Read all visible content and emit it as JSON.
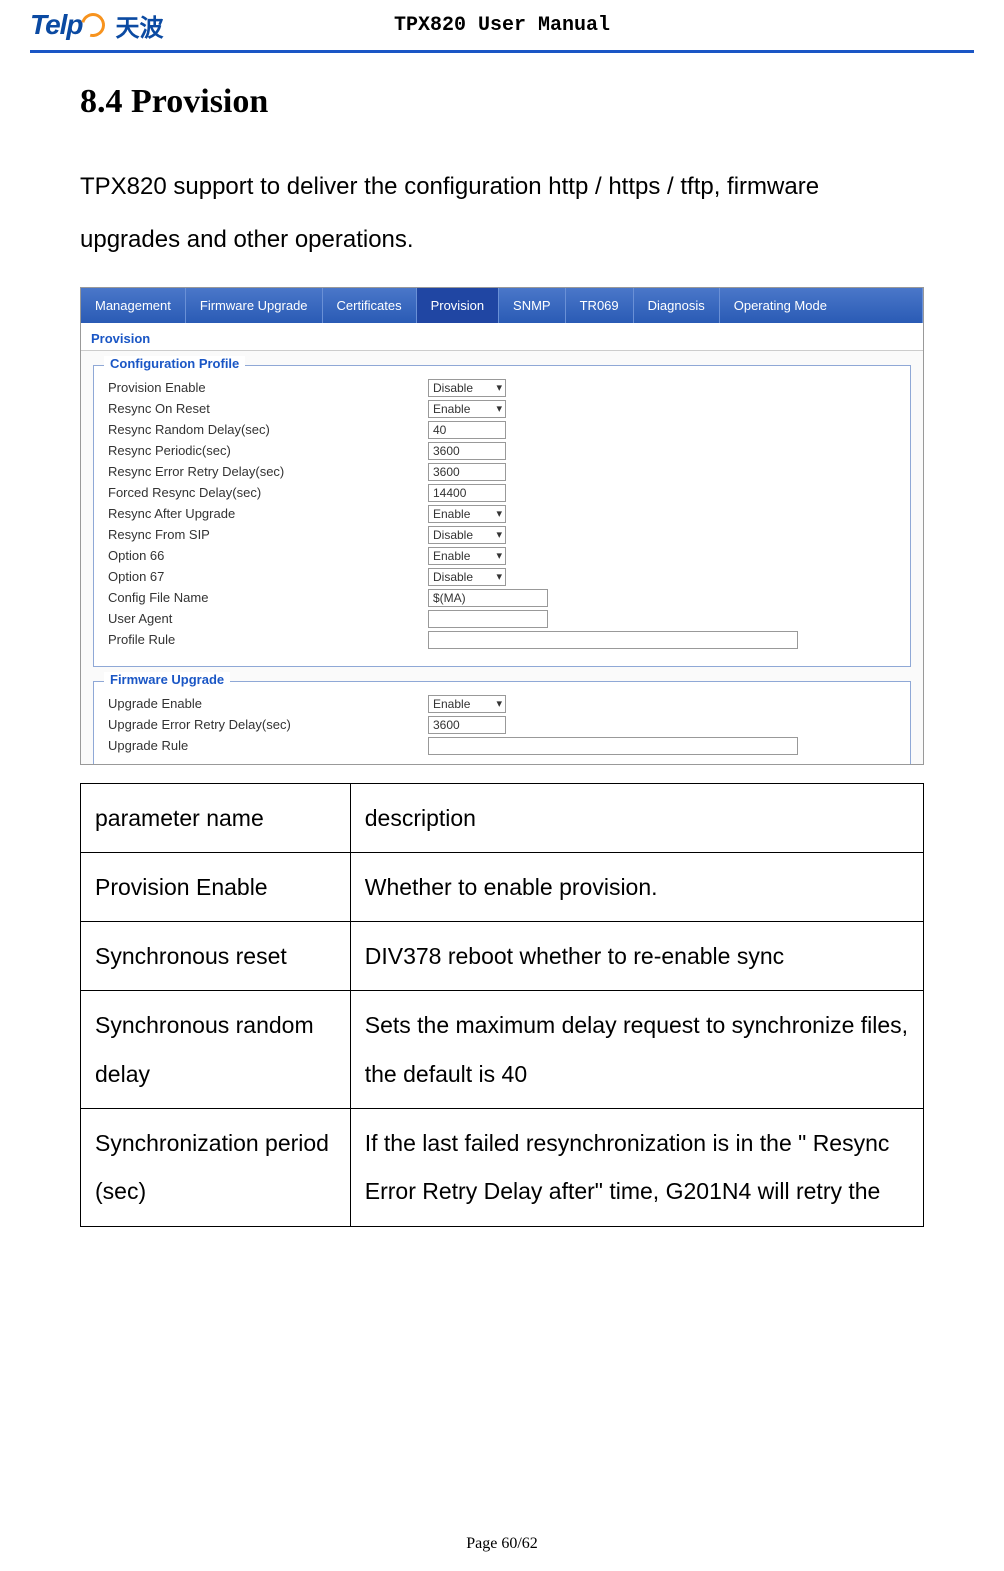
{
  "header": {
    "logo_en": "Telp",
    "logo_cn": "天波",
    "doc_title": "TPX820 User Manual"
  },
  "section": {
    "title": "8.4 Provision",
    "intro": "TPX820 support to deliver the configuration http / https / tftp, firmware upgrades and other operations."
  },
  "ui": {
    "tabs": [
      "Management",
      "Firmware Upgrade",
      "Certificates",
      "Provision",
      "SNMP",
      "TR069",
      "Diagnosis",
      "Operating Mode"
    ],
    "active_tab": "Provision",
    "section_header": "Provision",
    "group1": {
      "legend": "Configuration Profile",
      "rows": [
        {
          "label": "Provision Enable",
          "type": "select",
          "value": "Disable"
        },
        {
          "label": "Resync On Reset",
          "type": "select",
          "value": "Enable"
        },
        {
          "label": "Resync Random Delay(sec)",
          "type": "input-sm",
          "value": "40"
        },
        {
          "label": "Resync Periodic(sec)",
          "type": "input-sm",
          "value": "3600"
        },
        {
          "label": "Resync Error Retry Delay(sec)",
          "type": "input-sm",
          "value": "3600"
        },
        {
          "label": "Forced Resync Delay(sec)",
          "type": "input-sm",
          "value": "14400"
        },
        {
          "label": "Resync After Upgrade",
          "type": "select",
          "value": "Enable"
        },
        {
          "label": "Resync From SIP",
          "type": "select",
          "value": "Disable"
        },
        {
          "label": "Option 66",
          "type": "select",
          "value": "Enable"
        },
        {
          "label": "Option 67",
          "type": "select",
          "value": "Disable"
        },
        {
          "label": "Config File Name",
          "type": "input",
          "value": "$(MA)"
        },
        {
          "label": "User Agent",
          "type": "input",
          "value": ""
        },
        {
          "label": "Profile Rule",
          "type": "input-wide",
          "value": ""
        }
      ]
    },
    "group2": {
      "legend": "Firmware Upgrade",
      "rows": [
        {
          "label": "Upgrade Enable",
          "type": "select",
          "value": "Enable"
        },
        {
          "label": "Upgrade Error Retry Delay(sec)",
          "type": "input-sm",
          "value": "3600"
        },
        {
          "label": "Upgrade Rule",
          "type": "input-wide",
          "value": ""
        }
      ]
    }
  },
  "param_table": {
    "header": [
      "parameter name",
      "description"
    ],
    "rows": [
      [
        "Provision Enable",
        "Whether to enable provision."
      ],
      [
        "Synchronous reset",
        "DIV378 reboot whether to re-enable sync"
      ],
      [
        "Synchronous random delay",
        "Sets the maximum delay request to synchronize files, the default is 40"
      ],
      [
        "Synchronization period (sec)",
        "If the last failed resynchronization is in the \" Resync Error Retry Delay after\" time, G201N4 will retry the"
      ]
    ]
  },
  "footer": {
    "page": "Page 60/62"
  }
}
